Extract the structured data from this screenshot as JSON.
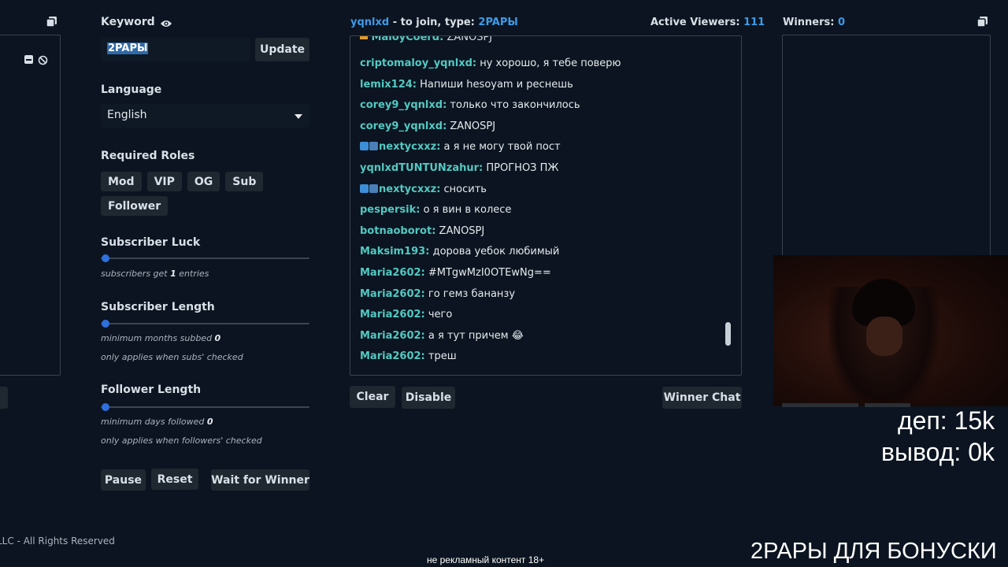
{
  "keyword": {
    "label": "Keyword",
    "value": "2PAPЫ",
    "update_label": "Update"
  },
  "language": {
    "label": "Language",
    "selected": "English"
  },
  "roles": {
    "label": "Required Roles",
    "items": [
      "Mod",
      "VIP",
      "OG",
      "Sub",
      "Follower"
    ]
  },
  "subscriber_luck": {
    "label": "Subscriber Luck",
    "note_prefix": "subscribers get",
    "value": "1",
    "note_suffix": "entries"
  },
  "subscriber_length": {
    "label": "Subscriber Length",
    "note_prefix": "minimum months subbed",
    "value": "0",
    "note2": "only applies when subs' checked"
  },
  "follower_length": {
    "label": "Follower Length",
    "note_prefix": "minimum days followed",
    "value": "0",
    "note2": "only applies when followers' checked"
  },
  "controls": {
    "pause": "Pause",
    "reset": "Reset",
    "wait": "Wait for Winner"
  },
  "chat_header": {
    "channel": "yqnlxd",
    "join_text": "- to join, type:",
    "keyword": "2PAPЫ",
    "viewers_label": "Active Viewers:",
    "viewers_count": "111"
  },
  "chat_messages": [
    {
      "user": "criptomaloy_yqnlxd:",
      "text": "ну хорошо, я тебе поверю",
      "badge": false
    },
    {
      "user": "lemix124:",
      "text": "Напиши hesoyam и реснешь",
      "badge": false
    },
    {
      "user": "corey9_yqnlxd:",
      "text": "только что закончилось",
      "badge": false
    },
    {
      "user": "corey9_yqnlxd:",
      "text": "ZANOSPJ",
      "badge": false
    },
    {
      "user": "nextycxxz:",
      "text": "а я не могу твой пост",
      "badge": true
    },
    {
      "user": "yqnlxdTUNTUNzahur:",
      "text": "ПРОГНОЗ ПЖ",
      "badge": false
    },
    {
      "user": "nextycxxz:",
      "text": "сносить",
      "badge": true
    },
    {
      "user": "pespersik:",
      "text": "о я вин в колесе",
      "badge": false
    },
    {
      "user": "botnaoborot:",
      "text": "ZANOSPJ",
      "badge": false
    },
    {
      "user": "Maksim193:",
      "text": "дорова уебок любимый",
      "badge": false
    },
    {
      "user": "Maria2602:",
      "text": "#MTgwMzI0OTEwNg==",
      "badge": false
    },
    {
      "user": "Maria2602:",
      "text": "го гемз бананзу",
      "badge": false
    },
    {
      "user": "Maria2602:",
      "text": "чего",
      "badge": false
    },
    {
      "user": "Maria2602:",
      "text": "а я тут причем 😂",
      "badge": false
    },
    {
      "user": "Maria2602:",
      "text": "треш",
      "badge": false
    }
  ],
  "chat_partial_top": "ZANOSPJ",
  "chat_buttons": {
    "clear": "Clear",
    "disable": "Disable",
    "winner_chat": "Winner Chat"
  },
  "winners": {
    "label": "Winners:",
    "count": "0"
  },
  "footer": {
    "rights": "LLC - All Rights Reserved"
  },
  "overlay": {
    "dep": "деп: 15k",
    "vyvod": "вывод: 0k",
    "bonus": "2PAPЫ ДЛЯ БОНУСКИ",
    "disclaimer": "не рекламный контент 18+"
  },
  "colors": {
    "accent": "#3e9be8",
    "chat_user": "#52c9c2",
    "slider": "#2f6fde",
    "background": "#0b1420"
  }
}
